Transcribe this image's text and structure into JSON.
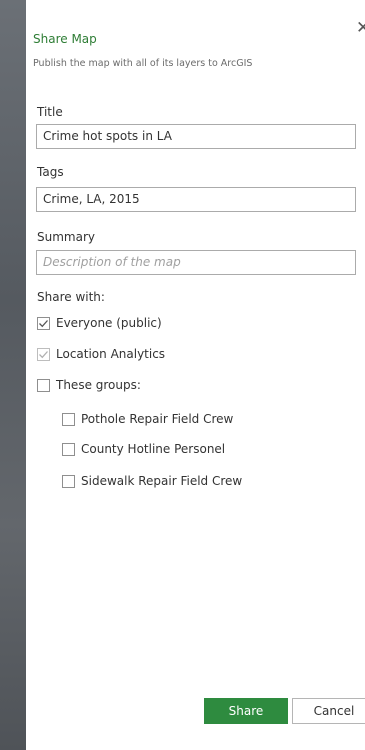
{
  "dialog": {
    "title": "Share Map",
    "subtitle": "Publish the map with all of its layers to ArcGIS",
    "close_glyph": "✕"
  },
  "fields": {
    "title_label": "Title",
    "title_value": "Crime hot spots in LA",
    "tags_label": "Tags",
    "tags_value": "Crime, LA, 2015",
    "summary_label": "Summary",
    "summary_placeholder": "Description of the map"
  },
  "share": {
    "label": "Share with:",
    "options": [
      {
        "label": "Everyone (public)",
        "checked": true,
        "disabled": false
      },
      {
        "label": "Location Analytics",
        "checked": true,
        "disabled": true
      },
      {
        "label": "These groups:",
        "checked": false,
        "disabled": false
      }
    ],
    "groups": [
      {
        "label": "Pothole Repair Field Crew",
        "checked": false
      },
      {
        "label": "County Hotline Personel",
        "checked": false
      },
      {
        "label": "Sidewalk Repair Field Crew",
        "checked": false
      }
    ]
  },
  "buttons": {
    "share_label": "Share",
    "cancel_label": "Cancel"
  },
  "colors": {
    "accent": "#2e8b3f",
    "title": "#2e7d35"
  }
}
